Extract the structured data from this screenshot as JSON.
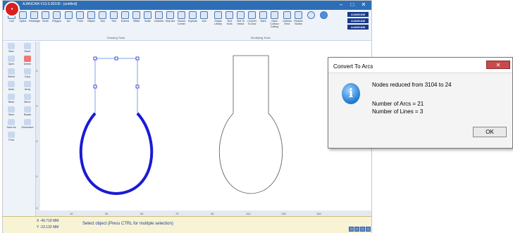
{
  "app": {
    "title": "AJANCAM V13.0.00100 - [untitled]",
    "window_controls": [
      "–",
      "□",
      "✕"
    ]
  },
  "drawing_tools": {
    "group_label": "Drawing Tools",
    "items": [
      "Line",
      "Spline",
      "Rectangle",
      "Circle",
      "Polygon",
      "Arc",
      "Point",
      "Ellipse",
      "Slot",
      "Trim",
      "Extend",
      "Offset",
      "Scale",
      "Chamfer",
      "Slop line",
      "Round Corner",
      "Explode",
      "Join"
    ]
  },
  "modifying_tools": {
    "group_label": "Modifying Tools",
    "items": [
      "Shape Library",
      "Text Tools",
      "Text To Vector",
      "Convert To Arcs",
      "Mark",
      "Open Contour Cutting",
      "Outlook Error",
      "Reduce Nodes"
    ]
  },
  "brand_buttons": [
    "AJANCAM",
    "AJANCAM",
    "AJANCAM"
  ],
  "left_tools": [
    "New",
    "Move",
    "Open",
    "Delete",
    "Select",
    "Copy",
    "Undo",
    "Array",
    "Redo",
    "Mirror",
    "Save",
    "Rotate",
    "Save As",
    "Dimension",
    "Print"
  ],
  "ruler": {
    "x_ticks": [
      "10",
      "20",
      "30",
      "40",
      "50",
      "60",
      "70",
      "80",
      "90",
      "100",
      "110",
      "120",
      "130",
      "140"
    ],
    "y_ticks": [
      "60",
      "50",
      "40",
      "30",
      "20"
    ]
  },
  "status": {
    "x_coord": "X -49.718 MM",
    "y_coord": "Y -23.132 MM",
    "message": "Select object (Press CTRL for multiple selection)"
  },
  "dialog": {
    "title": "Convert To Arcs",
    "close_label": "✕",
    "icon": "info-icon",
    "line1": "Nodes reduced from 3104 to 24",
    "line2": "Number of Arcs = 21",
    "line3": "Number of Lines = 3",
    "ok_label": "OK"
  },
  "colors": {
    "titlebar": "#2d6eb6",
    "selected_shape": "#1a1ad6",
    "selection_lines": "#7aa6e8",
    "status_bg": "#f7f3d4"
  }
}
